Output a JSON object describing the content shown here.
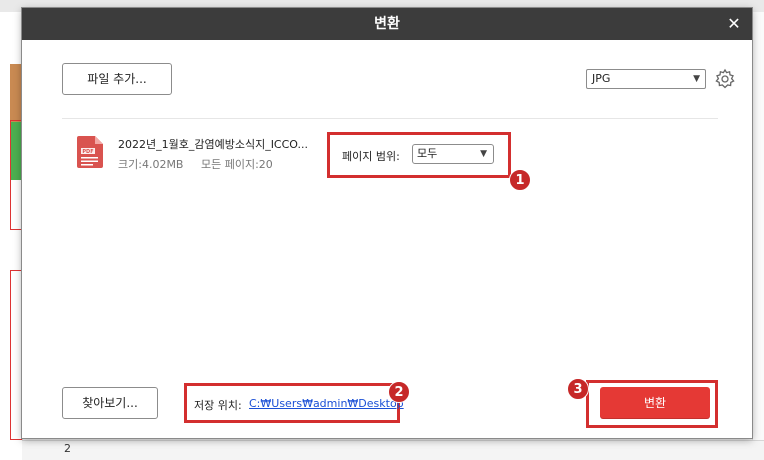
{
  "dialog": {
    "title": "변환",
    "close_glyph": "✕"
  },
  "toolbar": {
    "add_file_label": "파일 추가...",
    "format_value": "JPG",
    "format_arrow": "▼"
  },
  "file": {
    "name": "2022년_1월호_감염예방소식지_ICCO...",
    "size": "크기:4.02MB",
    "pages": "모든 페이지:20"
  },
  "page_range": {
    "label": "페이지 범위:",
    "value": "모두",
    "arrow": "▼"
  },
  "footer": {
    "browse_label": "찾아보기...",
    "save_label": "저장 위치:",
    "save_path": "C:₩Users₩admin₩Desktop",
    "convert_label": "변환"
  },
  "annotations": [
    "1",
    "2",
    "3"
  ],
  "background": {
    "page_number": "2"
  },
  "colors": {
    "titlebar": "#3c3c3c",
    "accent_red": "#e53935",
    "highlight_border": "#d32f2f",
    "link": "#1a4fd6"
  }
}
